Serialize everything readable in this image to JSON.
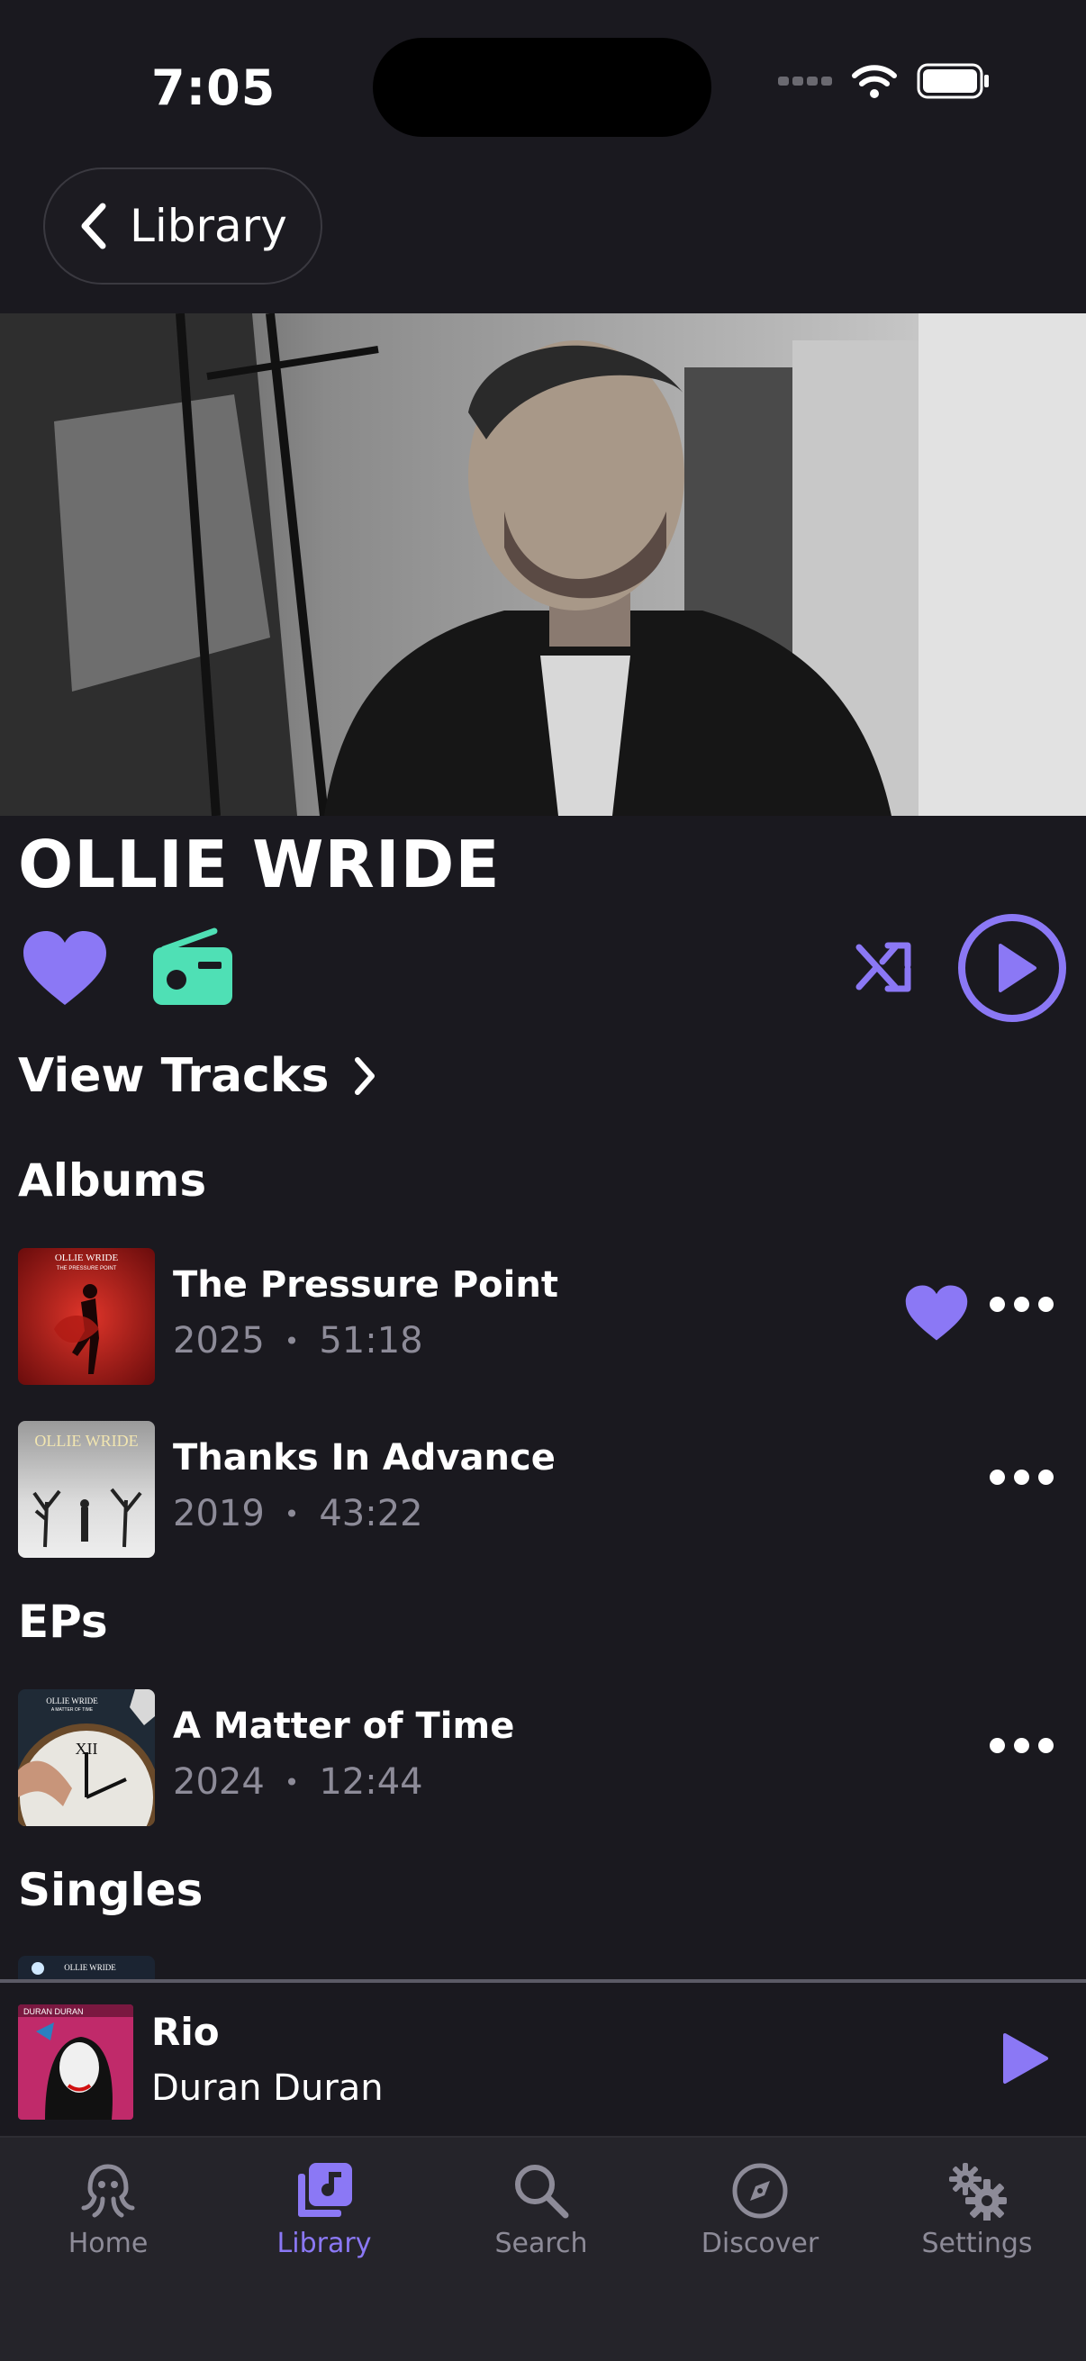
{
  "status": {
    "time": "7:05"
  },
  "nav": {
    "back_label": "Library"
  },
  "artist": {
    "name": "OLLIE WRIDE"
  },
  "view_tracks_label": "View Tracks",
  "sections": {
    "albums": "Albums",
    "eps": "EPs",
    "singles": "Singles"
  },
  "albums": [
    {
      "title": "The Pressure Point",
      "year": "2025",
      "duration": "51:18",
      "favorite": true,
      "cover_text": "OLLIE WRIDE",
      "cover_sub": "THE PRESSURE POINT"
    },
    {
      "title": "Thanks In Advance",
      "year": "2019",
      "duration": "43:22",
      "favorite": false,
      "cover_text": "OLLIE WRIDE"
    }
  ],
  "eps": [
    {
      "title": "A Matter of Time",
      "year": "2024",
      "duration": "12:44",
      "cover_text": "OLLIE WRIDE",
      "cover_sub": "A MATTER OF TIME"
    }
  ],
  "singles_peek": {
    "cover_text": "OLLIE WRIDE"
  },
  "now_playing": {
    "title": "Rio",
    "artist": "Duran Duran",
    "cover_text": "DURAN DURAN"
  },
  "tabs": [
    {
      "label": "Home",
      "icon": "octopus-icon",
      "active": false
    },
    {
      "label": "Library",
      "icon": "music-library-icon",
      "active": true
    },
    {
      "label": "Search",
      "icon": "search-icon",
      "active": false
    },
    {
      "label": "Discover",
      "icon": "compass-icon",
      "active": false
    },
    {
      "label": "Settings",
      "icon": "gears-icon",
      "active": false
    }
  ],
  "colors": {
    "background": "#1a191f",
    "accent": "#8b78f5",
    "radio": "#4fe0b5",
    "muted": "#8d8b98",
    "tabbar": "#25242a"
  }
}
